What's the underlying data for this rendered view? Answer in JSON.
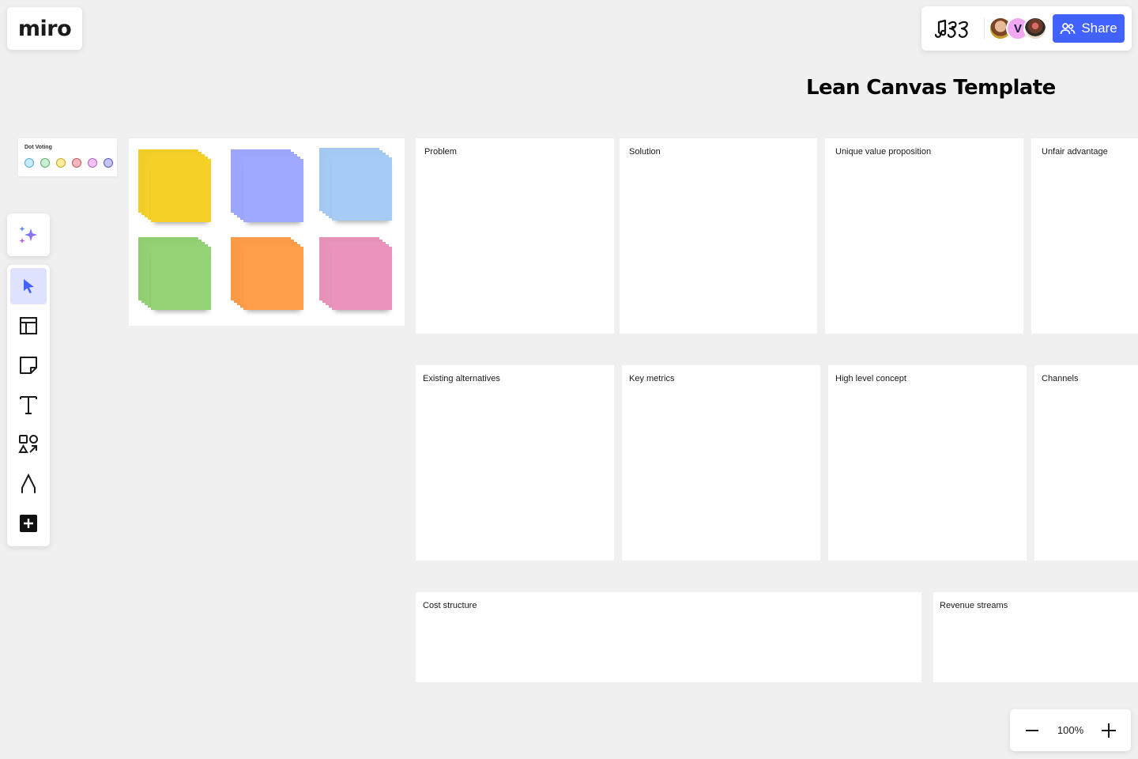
{
  "app": {
    "logo_text": "miro"
  },
  "header": {
    "board_icon": "music-notes-icon",
    "collaborators": [
      {
        "name": "collaborator-1",
        "initial": ""
      },
      {
        "name": "collaborator-2",
        "initial": "V"
      },
      {
        "name": "collaborator-3",
        "initial": ""
      }
    ],
    "share_label": "Share",
    "share_color": "#4262ff"
  },
  "canvas": {
    "title": "Lean Canvas Template",
    "dot_voting": {
      "title": "Dot Voting",
      "dots": [
        {
          "fill": "#c5ecfb",
          "stroke": "#5aa9d6"
        },
        {
          "fill": "#c9f0d2",
          "stroke": "#56b36e"
        },
        {
          "fill": "#fbeb9b",
          "stroke": "#c9a629"
        },
        {
          "fill": "#f6b8be",
          "stroke": "#c9525c"
        },
        {
          "fill": "#f4c2f5",
          "stroke": "#b060c6"
        },
        {
          "fill": "#c4c4f6",
          "stroke": "#5b5bbf"
        }
      ]
    },
    "sticky_stacks": [
      {
        "color_name": "yellow",
        "color": "#f5d128"
      },
      {
        "color_name": "violet",
        "color": "#9ea9ff"
      },
      {
        "color_name": "light-blue",
        "color": "#a6ccf5"
      },
      {
        "color_name": "green",
        "color": "#93d275"
      },
      {
        "color_name": "orange",
        "color": "#ff9d48"
      },
      {
        "color_name": "pink",
        "color": "#ea94bb"
      }
    ],
    "sections": {
      "problem": "Problem",
      "solution": "Solution",
      "uvp": "Unique value proposition",
      "unfair_advantage": "Unfair advantage",
      "existing_alternatives": "Existing alternatives",
      "key_metrics": "Key metrics",
      "high_level_concept": "High level concept",
      "channels": "Channels",
      "cost_structure": "Cost structure",
      "revenue_streams": "Revenue streams"
    }
  },
  "toolbar": {
    "ai": "AI assistant",
    "tools": [
      {
        "name": "select",
        "active": true
      },
      {
        "name": "templates",
        "active": false
      },
      {
        "name": "sticky-note",
        "active": false
      },
      {
        "name": "text",
        "active": false
      },
      {
        "name": "shapes",
        "active": false
      },
      {
        "name": "pen",
        "active": false
      },
      {
        "name": "more",
        "active": false
      }
    ]
  },
  "zoom": {
    "value": "100%",
    "minus": "zoom-out",
    "plus": "zoom-in"
  }
}
